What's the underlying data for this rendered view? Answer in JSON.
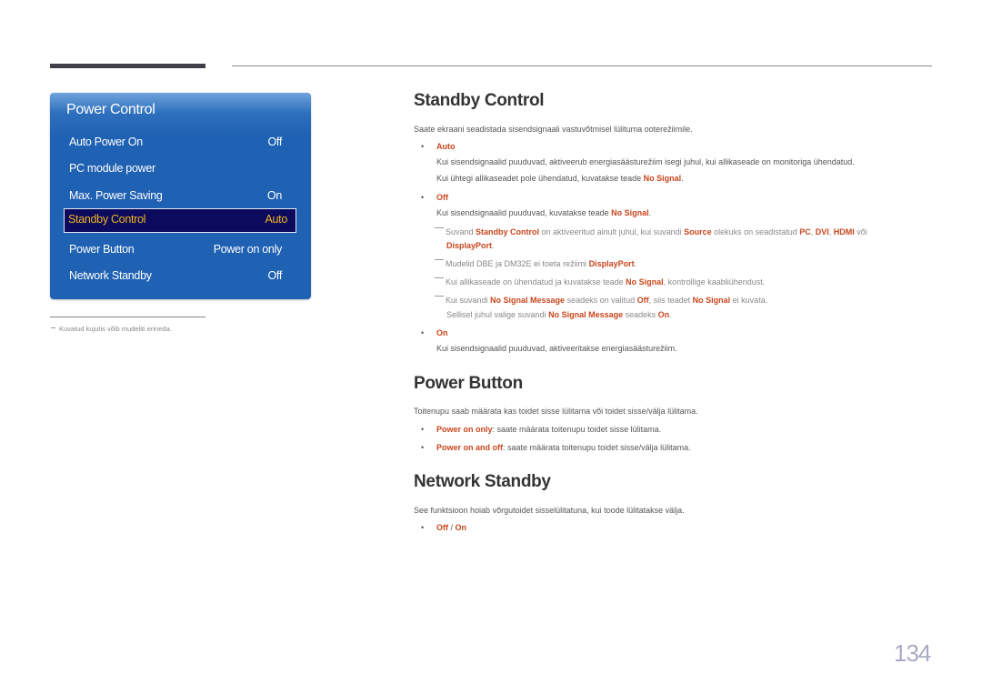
{
  "menu": {
    "title": "Power Control",
    "items": [
      {
        "label": "Auto Power On",
        "value": "Off"
      },
      {
        "label": "PC module power",
        "value": ""
      },
      {
        "label": "Max. Power Saving",
        "value": "On"
      },
      {
        "label": "Standby Control",
        "value": "Auto",
        "selected": true
      },
      {
        "label": "Power Button",
        "value": "Power on only"
      },
      {
        "label": "Network Standby",
        "value": "Off"
      }
    ]
  },
  "footnote": "Kuvatud kujutis võib mudeliti erineda.",
  "sections": {
    "standby": {
      "title": "Standby Control",
      "intro": "Saate ekraani seadistada sisendsignaali vastuvõtmisel lülituma ooterežiimile.",
      "auto_label": "Auto",
      "auto_desc1": "Kui sisendsignaalid puuduvad, aktiveerub energiasäästurežiim isegi juhul, kui allikaseade on monitoriga ühendatud.",
      "auto_desc2_pre": "Kui ühtegi allikaseadet pole ühendatud, kuvatakse teade ",
      "no_signal": "No Signal",
      "off_label": "Off",
      "off_desc_pre": "Kui sisendsignaalid puuduvad, kuvatakse teade ",
      "note1_a": "Suvand ",
      "note1_b": "Standby Control",
      "note1_c": " on aktiveeritud ainult juhul, kui suvandi ",
      "note1_d": "Source",
      "note1_e": " olekuks on seadistatud ",
      "pc": "PC",
      "dvi": "DVI",
      "hdmi": "HDMI",
      "voi": " või",
      "displayport": "DisplayPort",
      "note2_pre": "Mudelid DBE ja DM32E ei toeta režiimi ",
      "note3_pre": "Kui allikaseade on ühendatud ja kuvatakse teade ",
      "note3_post": ", kontrollige kaabliühendust.",
      "note4_a": "Kui suvandi ",
      "no_signal_message": "No Signal Message",
      "note4_b": " seadeks on valitud ",
      "note4_c": ", siis teadet ",
      "note4_d": " ei kuvata.",
      "note4_e": "Sellisel juhul valige suvandi ",
      "note4_f": " seadeks ",
      "on_label": "On",
      "on_desc": "Kui sisendsignaalid puuduvad, aktiveeritakse energiasäästurežiim."
    },
    "power_button": {
      "title": "Power Button",
      "intro": "Toitenupu saab määrata kas toidet sisse lülitama või toidet sisse/välja lülitama.",
      "opt1_label": "Power on only",
      "opt1_desc": ": saate määrata toitenupu toidet sisse lülitama.",
      "opt2_label": "Power on and off",
      "opt2_desc": ": saate määrata toitenupu toidet sisse/välja lülitama."
    },
    "network_standby": {
      "title": "Network Standby",
      "intro": "See funktsioon hoiab võrgutoidet sisselülitatuna, kui toode lülitatakse välja.",
      "opt_off": "Off",
      "opt_sep": " / ",
      "opt_on": "On"
    }
  },
  "page_number": "134",
  "bullet_char": "•",
  "period": ".",
  "comma": ", "
}
